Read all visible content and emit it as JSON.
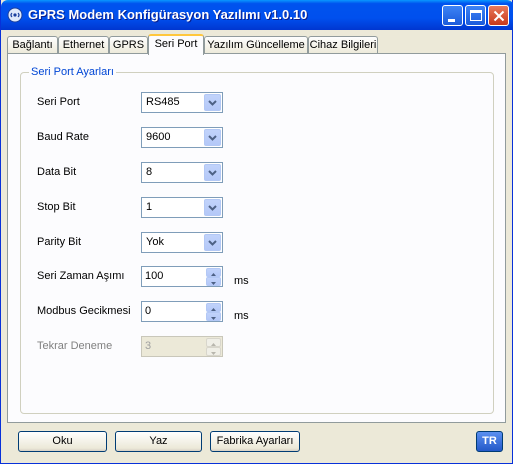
{
  "window": {
    "title": "GPRS Modem Konfigürasyon Yazılımı v1.0.10",
    "icon": "modem-signal-icon"
  },
  "tabs": [
    "Bağlantı",
    "Ethernet",
    "GPRS",
    "Seri Port",
    "Yazılım Güncelleme",
    "Cihaz Bilgileri"
  ],
  "active_tab": "Seri Port",
  "group": {
    "title": "Seri Port Ayarları",
    "fields": [
      {
        "label": "Seri Port",
        "value": "RS485",
        "control": "combo"
      },
      {
        "label": "Baud Rate",
        "value": "9600",
        "control": "combo"
      },
      {
        "label": "Data Bit",
        "value": "8",
        "control": "combo"
      },
      {
        "label": "Stop Bit",
        "value": "1",
        "control": "combo"
      },
      {
        "label": "Parity Bit",
        "value": "Yok",
        "control": "combo"
      },
      {
        "label": "Seri Zaman Aşımı",
        "value": "100",
        "unit": "ms",
        "control": "spin"
      },
      {
        "label": "Modbus Gecikmesi",
        "value": "0",
        "unit": "ms",
        "control": "spin"
      },
      {
        "label": "Tekrar Deneme",
        "value": "3",
        "control": "spin",
        "enabled": false
      }
    ]
  },
  "buttons": {
    "read": "Oku",
    "write": "Yaz",
    "factory": "Fabrika Ayarları",
    "language": "TR"
  },
  "colors": {
    "titlebar": "#0054e3",
    "group_title": "#0046d5",
    "active_tab_accent": "#ffc73c"
  }
}
